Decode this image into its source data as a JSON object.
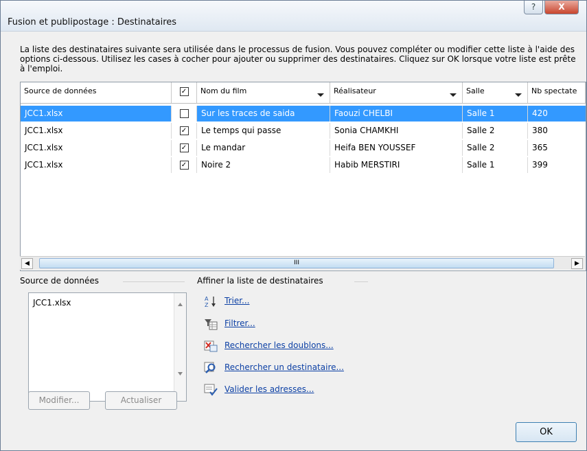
{
  "window": {
    "title": "Fusion et publipostage : Destinataires",
    "help_label": "?",
    "close_label": "X"
  },
  "intro_text": "La liste des destinataires suivante sera utilisée dans le processus de fusion. Vous pouvez compléter ou modifier cette liste à l'aide des options ci-dessous. Utilisez les cases à cocher pour ajouter ou supprimer des destinataires. Cliquez sur OK lorsque votre liste est prête à l'emploi.",
  "table": {
    "columns": [
      "Source de données",
      "",
      "Nom du film",
      "Réalisateur",
      "Salle",
      "Nb spectate"
    ],
    "rows": [
      {
        "source": "JCC1.xlsx",
        "checked": true,
        "film": "Sur les traces de saida",
        "director": "Faouzi CHELBI",
        "room": "Salle 1",
        "count": "420"
      },
      {
        "source": "JCC1.xlsx",
        "checked": true,
        "film": "Le temps qui passe",
        "director": "Sonia CHAMKHI",
        "room": "Salle 2",
        "count": "380"
      },
      {
        "source": "JCC1.xlsx",
        "checked": true,
        "film": "Le mandar",
        "director": "Heifa BEN YOUSSEF",
        "room": "Salle 2",
        "count": "365"
      },
      {
        "source": "JCC1.xlsx",
        "checked": true,
        "film": "Noire 2",
        "director": "Habib MERSTIRI",
        "room": "Salle 1",
        "count": "399"
      }
    ],
    "selected_row": 0
  },
  "scroll": {
    "left": "◀",
    "right": "▶",
    "thumb": "III"
  },
  "data_sources": {
    "heading": "Source de données",
    "items": [
      "JCC1.xlsx"
    ],
    "modify_button": "Modifier...",
    "refresh_button": "Actualiser"
  },
  "refine": {
    "heading": "Affiner la liste de destinataires",
    "sort": "Trier...",
    "filter": "Filtrer...",
    "duplicates": "Rechercher les doublons...",
    "find": "Rechercher un destinataire...",
    "validate": "Valider les adresses..."
  },
  "ok_button": "OK",
  "colors": {
    "selection": "#3399ff",
    "link": "#0b3fa4"
  }
}
